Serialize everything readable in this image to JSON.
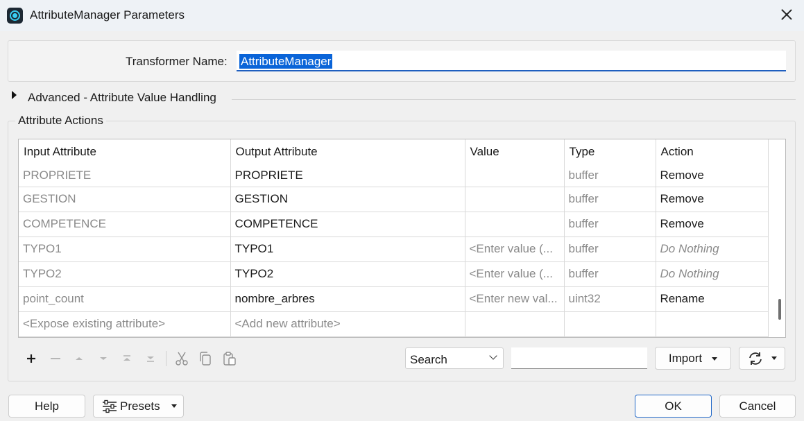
{
  "window": {
    "title": "AttributeManager Parameters"
  },
  "transformer": {
    "label": "Transformer Name:",
    "value": "AttributeManager"
  },
  "advanced": {
    "label": "Advanced - Attribute Value Handling"
  },
  "actions": {
    "title": "Attribute Actions",
    "columns": [
      "Input Attribute",
      "Output Attribute",
      "Value",
      "Type",
      "Action"
    ],
    "rows": [
      {
        "input": "PROPRIETE",
        "output": "PROPRIETE",
        "value": "",
        "type": "buffer",
        "action": "Remove"
      },
      {
        "input": "GESTION",
        "output": "GESTION",
        "value": "",
        "type": "buffer",
        "action": "Remove"
      },
      {
        "input": "COMPETENCE",
        "output": "COMPETENCE",
        "value": "",
        "type": "buffer",
        "action": "Remove"
      },
      {
        "input": "TYPO1",
        "output": "TYPO1",
        "value": "<Enter value (...",
        "type": "buffer",
        "action": "Do Nothing"
      },
      {
        "input": "TYPO2",
        "output": "TYPO2",
        "value": "<Enter value (...",
        "type": "buffer",
        "action": "Do Nothing"
      },
      {
        "input": "point_count",
        "output": "nombre_arbres",
        "value": "<Enter new val...",
        "type": "uint32",
        "action": "Rename"
      },
      {
        "input": "<Expose existing attribute>",
        "output": "<Add new attribute>",
        "value": "",
        "type": "",
        "action": ""
      }
    ]
  },
  "toolbar": {
    "icons": [
      "plus-icon",
      "minus-icon",
      "move-up-icon",
      "move-down-icon",
      "move-top-icon",
      "move-bottom-icon",
      "cut-icon",
      "copy-icon",
      "paste-icon"
    ],
    "search_mode": "Search",
    "search_value": "",
    "import_label": "Import"
  },
  "footer": {
    "help_label": "Help",
    "presets_label": "Presets",
    "ok_label": "OK",
    "cancel_label": "Cancel"
  },
  "colors": {
    "accent": "#0a64d8",
    "muted_text": "#8a8a8a"
  }
}
